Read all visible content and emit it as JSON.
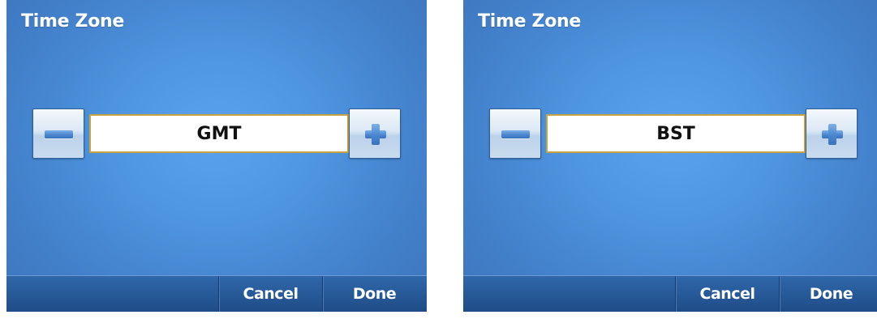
{
  "screens": [
    {
      "title": "Time Zone",
      "value": "GMT",
      "cancel_label": "Cancel",
      "done_label": "Done"
    },
    {
      "title": "Time Zone",
      "value": "BST",
      "cancel_label": "Cancel",
      "done_label": "Done"
    }
  ],
  "icons": {
    "decrease": "minus-icon",
    "increase": "plus-icon"
  },
  "colors": {
    "background": "#4f96e0",
    "bottom_bar": "#275a99",
    "field_border": "#c9a33d",
    "icon_blue": "#4a86cf"
  }
}
